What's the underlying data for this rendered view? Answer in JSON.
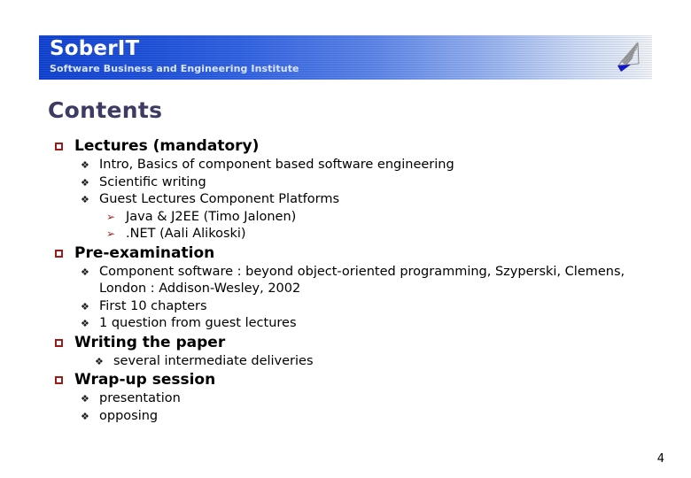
{
  "banner": {
    "brand_title": "SoberIT",
    "brand_subtitle": "Software Business and Engineering Institute",
    "logo_icon": "sail-logo-icon",
    "gradient_start_color": "#0b3fd6",
    "gradient_end_color": "#f7fafe"
  },
  "slide": {
    "title": "Contents",
    "title_color": "#3b3b63",
    "page_number": "4"
  },
  "bullets": {
    "level1_glyph": "square-outline-bullet",
    "level1_color": "#9d1b1b",
    "level2_glyph": "❖",
    "level2_color": "#1a1a1a",
    "level3_glyph": "➢",
    "level3_color": "#9d1b1b"
  },
  "outline": [
    {
      "label": "Lectures (mandatory)",
      "children": [
        {
          "label": "Intro, Basics of component based software engineering"
        },
        {
          "label": "Scientific writing"
        },
        {
          "label": "Guest Lectures Component Platforms",
          "children": [
            {
              "label": "Java & J2EE (Timo Jalonen)"
            },
            {
              "label": ".NET (Aali Alikoski)"
            }
          ]
        }
      ]
    },
    {
      "label": "Pre-examination",
      "children": [
        {
          "label": "Component software : beyond object-oriented programming,  Szyperski, Clemens, London : Addison-Wesley, 2002",
          "wrapped": true
        },
        {
          "label": "First 10 chapters"
        },
        {
          "label": "1 question from guest lectures"
        }
      ]
    },
    {
      "label": "Writing the paper",
      "children": [
        {
          "label": "several intermediate deliveries",
          "extra_indent": true
        }
      ]
    },
    {
      "label": "Wrap-up session",
      "children": [
        {
          "label": "presentation"
        },
        {
          "label": "opposing"
        }
      ]
    }
  ]
}
